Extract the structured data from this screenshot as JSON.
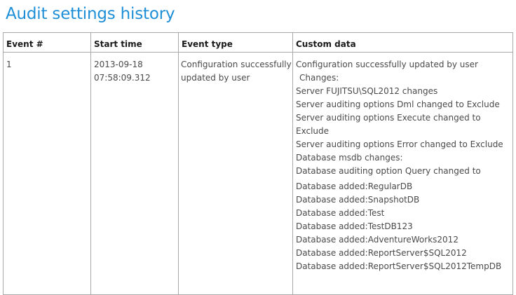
{
  "page": {
    "title": "Audit settings history"
  },
  "table": {
    "headers": [
      "Event #",
      "Start time",
      "Event type",
      "Custom data"
    ],
    "rows": [
      {
        "event_number": "1",
        "start_time": "2013-09-18 07:58:09.312",
        "event_type": "Configuration successfully updated by user",
        "custom_data": [
          "Configuration successfully updated by user",
          "Changes:",
          "Server FUJITSU\\SQL2012 changes",
          "Server auditing options Dml changed to Exclude",
          "Server auditing options Execute changed to Exclude",
          "Server auditing options Error changed to Exclude",
          "Database msdb changes:",
          "Database auditing option Query changed to",
          "Database added:RegularDB",
          "Database added:SnapshotDB",
          "Database added:Test",
          "Database added:TestDB123",
          "Database added:AdventureWorks2012",
          "Database added:ReportServer$SQL2012",
          "Database added:ReportServer$SQL2012TempDB"
        ]
      }
    ]
  },
  "colors": {
    "title": "#1e8fd6",
    "border": "#a9a9a9",
    "text": "#4a4a4a"
  }
}
